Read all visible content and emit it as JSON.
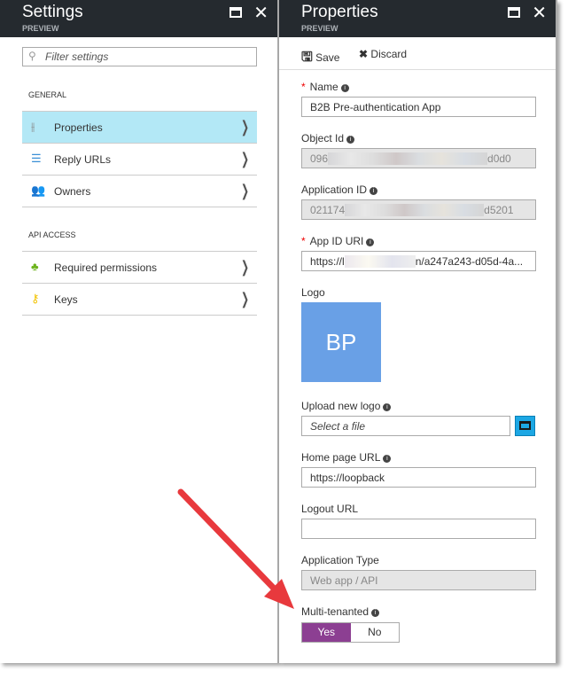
{
  "settings": {
    "title": "Settings",
    "subtitle": "PREVIEW",
    "filter_placeholder": "Filter settings",
    "sections": [
      {
        "heading": "GENERAL",
        "items": [
          {
            "label": "Properties",
            "icon": "sliders-icon",
            "selected": true
          },
          {
            "label": "Reply URLs",
            "icon": "checklist-icon"
          },
          {
            "label": "Owners",
            "icon": "people-icon"
          }
        ]
      },
      {
        "heading": "API ACCESS",
        "items": [
          {
            "label": "Required permissions",
            "icon": "hierarchy-icon"
          },
          {
            "label": "Keys",
            "icon": "key-icon"
          }
        ]
      }
    ]
  },
  "properties": {
    "title": "Properties",
    "subtitle": "PREVIEW",
    "save_label": "Save",
    "discard_label": "Discard",
    "name_label": "Name",
    "name_value": "B2B Pre-authentication App",
    "object_id_label": "Object Id",
    "object_id_start": "096",
    "object_id_end": "d0d0",
    "app_id_label": "Application ID",
    "app_id_start": "021174",
    "app_id_end": "d5201",
    "app_id_uri_label": "App ID URI",
    "app_id_uri_start": "https://l",
    "app_id_uri_end": "n/a247a243-d05d-4a...",
    "logo_label": "Logo",
    "logo_initials": "BP",
    "logo_color": "#69a0e6",
    "upload_label": "Upload new logo",
    "upload_placeholder": "Select a file",
    "homepage_label": "Home page URL",
    "homepage_value": "https://loopback",
    "logout_label": "Logout URL",
    "logout_value": "",
    "app_type_label": "Application Type",
    "app_type_value": "Web app / API",
    "multitenant_label": "Multi-tenanted",
    "yes_label": "Yes",
    "no_label": "No",
    "multitenant_selected": "Yes",
    "accent_color": "#8c3f92"
  }
}
